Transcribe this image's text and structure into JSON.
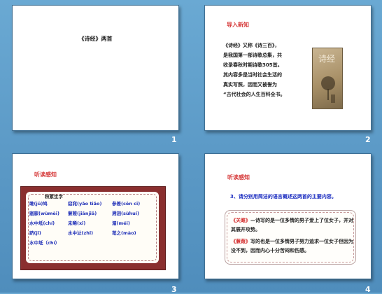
{
  "slides": [
    {
      "title": "《诗经》两首"
    },
    {
      "heading": "导入新知",
      "body": [
        "《诗经》又称《诗三百》，",
        "是我国第一部诗歌总集，共",
        "收录春秋时期诗歌305首。",
        "其内容多是当时社会生活的",
        "真实写照，因而又被誉为",
        "“古代社会的人生百科全书。"
      ],
      "book_title": "诗经"
    },
    {
      "heading": "听读感知",
      "vocab_title": "积累生字",
      "vocab": [
        [
          "雎(jū)鸠",
          "窈窕(yǎo tiǎo)",
          "参差(cēn cī)"
        ],
        [
          "寤寐(wùmèi)",
          "蒹葭(jiānjiā)",
          "溯洄(sùhuí)"
        ],
        [
          "水中坻(chí)",
          "未晞(xī)",
          "湄(méi)"
        ],
        [
          "跻(jī)",
          "水中沚(zhǐ)",
          "芼之(mào)"
        ],
        [
          "水中坻（chí）",
          "",
          ""
        ]
      ]
    },
    {
      "heading": "听读感知",
      "question": "3、请分别用简洁的语言概述这两首的主要内容。",
      "answer1_title": "《关雎》",
      "answer1": "—诗写的是一位多情的男子爱上了位女子，并对其展开攻势。",
      "answer2_title": "《蒹葭》",
      "answer2": "写的也是一位多情男子努力追求一位女子但因为没不到，因而内心十分苦闷和伤感。"
    }
  ],
  "slide_numbers": [
    "1",
    "2",
    "3",
    "4"
  ]
}
